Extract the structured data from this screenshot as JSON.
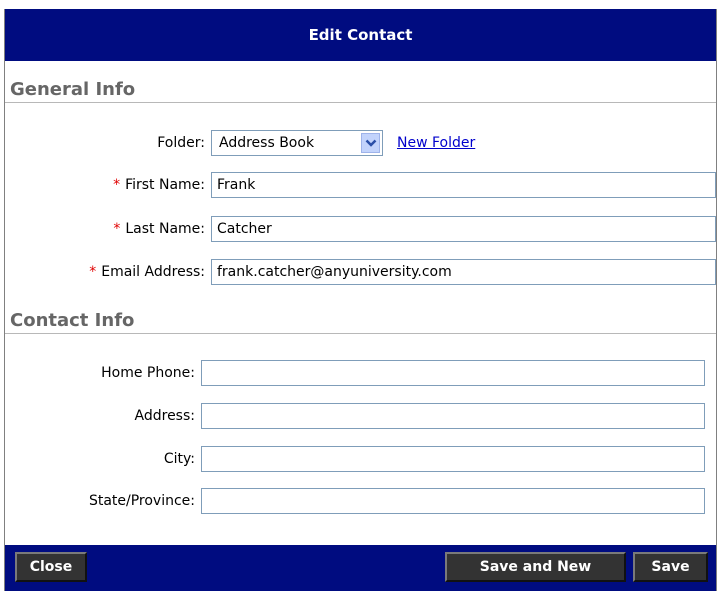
{
  "dialog": {
    "title": "Edit Contact"
  },
  "general_info": {
    "header": "General Info",
    "folder": {
      "label": "Folder:",
      "selected": "Address Book",
      "new_folder_link": "New Folder"
    },
    "first_name": {
      "required_marker": "*",
      "label": "First Name:",
      "value": "Frank"
    },
    "last_name": {
      "required_marker": "*",
      "label": "Last Name:",
      "value": "Catcher"
    },
    "email": {
      "required_marker": "*",
      "label": "Email Address:",
      "value": "frank.catcher@anyuniversity.com"
    }
  },
  "contact_info": {
    "header": "Contact Info",
    "home_phone": {
      "label": "Home Phone:",
      "value": ""
    },
    "address": {
      "label": "Address:",
      "value": ""
    },
    "city": {
      "label": "City:",
      "value": ""
    },
    "state": {
      "label": "State/Province:",
      "value": ""
    }
  },
  "footer": {
    "close_label": "Close",
    "save_and_new_label": "Save and New",
    "save_label": "Save"
  },
  "colors": {
    "titlebar": "#000c80",
    "required": "#e00000",
    "link": "#0000cc",
    "button": "#333333"
  }
}
